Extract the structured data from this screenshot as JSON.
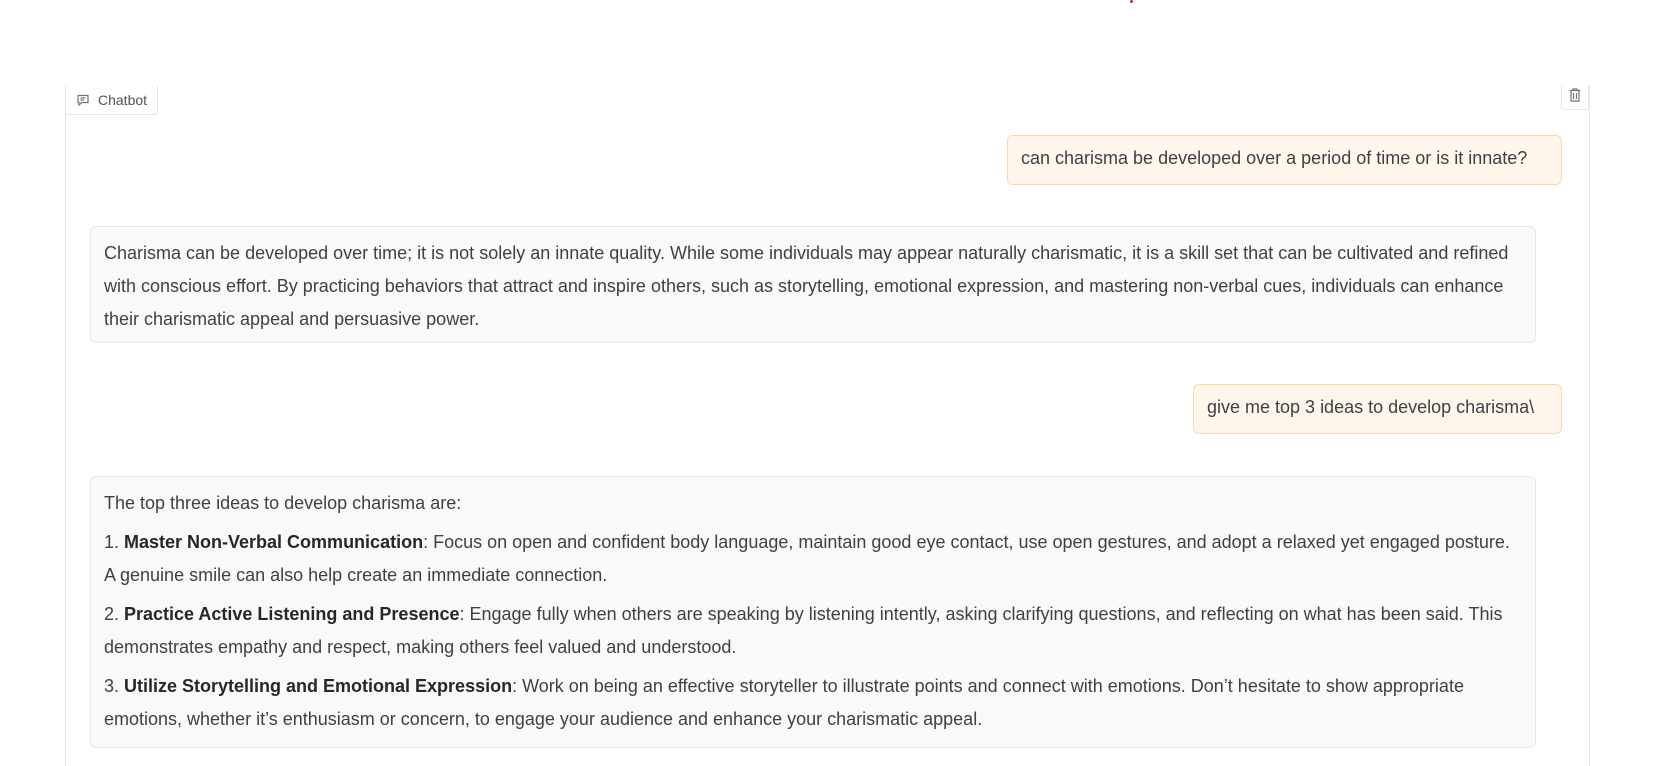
{
  "chatbot": {
    "label": "Chatbot",
    "icon": "chat-icon",
    "clear_icon": "trash-icon"
  },
  "messages": {
    "user1": "can charisma be developed over a period of time or is it innate?",
    "bot1": "Charisma can be developed over time; it is not solely an innate quality. While some individuals may appear naturally charismatic, it is a skill set that can be cultivated and refined with conscious effort. By practicing behaviors that attract and inspire others, such as storytelling, emotional expression, and mastering non-verbal cues, individuals can enhance their charismatic appeal and persuasive power.",
    "user2": "give me top 3 ideas to develop charisma\\",
    "bot2": {
      "intro": "The top three ideas to develop charisma are:",
      "items": [
        {
          "num": "1. ",
          "title": "Master Non-Verbal Communication",
          "text": ": Focus on open and confident body language, maintain good eye contact, use open gestures, and adopt a relaxed yet engaged posture. A genuine smile can also help create an immediate connection."
        },
        {
          "num": "2. ",
          "title": "Practice Active Listening and Presence",
          "text": ": Engage fully when others are speaking by listening intently, asking clarifying questions, and reflecting on what has been said. This demonstrates empathy and respect, making others feel valued and understood."
        },
        {
          "num": "3. ",
          "title": "Utilize Storytelling and Emotional Expression",
          "text": ": Work on being an effective storyteller to illustrate points and connect with emotions. Don’t hesitate to show appropriate emotions, whether it’s enthusiasm or concern, to engage your audience and enhance your charismatic appeal."
        }
      ]
    }
  },
  "colors": {
    "user_bubble": "#fff7ec",
    "user_border": "#fcd9a8",
    "bot_bubble": "#f9f9f9"
  }
}
